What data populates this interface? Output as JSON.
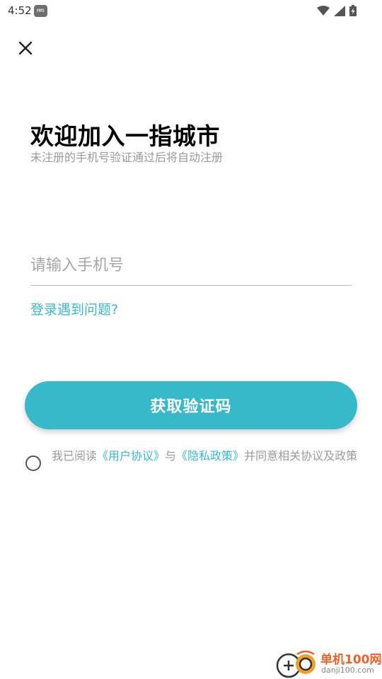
{
  "status_bar": {
    "time": "4:52",
    "notif_icon": "sim-card-icon",
    "notif_label": "MMS"
  },
  "close_icon": "close-icon",
  "title": "欢迎加入一指城市",
  "subtitle": "未注册的手机号验证通过后将自动注册",
  "phone_input": {
    "placeholder": "请输入手机号",
    "value": ""
  },
  "login_help": "登录遇到问题?",
  "get_code_button": "获取验证码",
  "agreement": {
    "checked": false,
    "prefix": "我已阅读",
    "user_agreement": "《用户协议》",
    "conjunction": "与",
    "privacy_policy": "《隐私政策》",
    "suffix": "并同意相关协议及政策"
  },
  "watermark": {
    "name": "单机100网",
    "url": "danji100.com"
  },
  "colors": {
    "accent": "#38b9ca",
    "link": "#3bb7c9",
    "watermark": "#e5642a"
  }
}
